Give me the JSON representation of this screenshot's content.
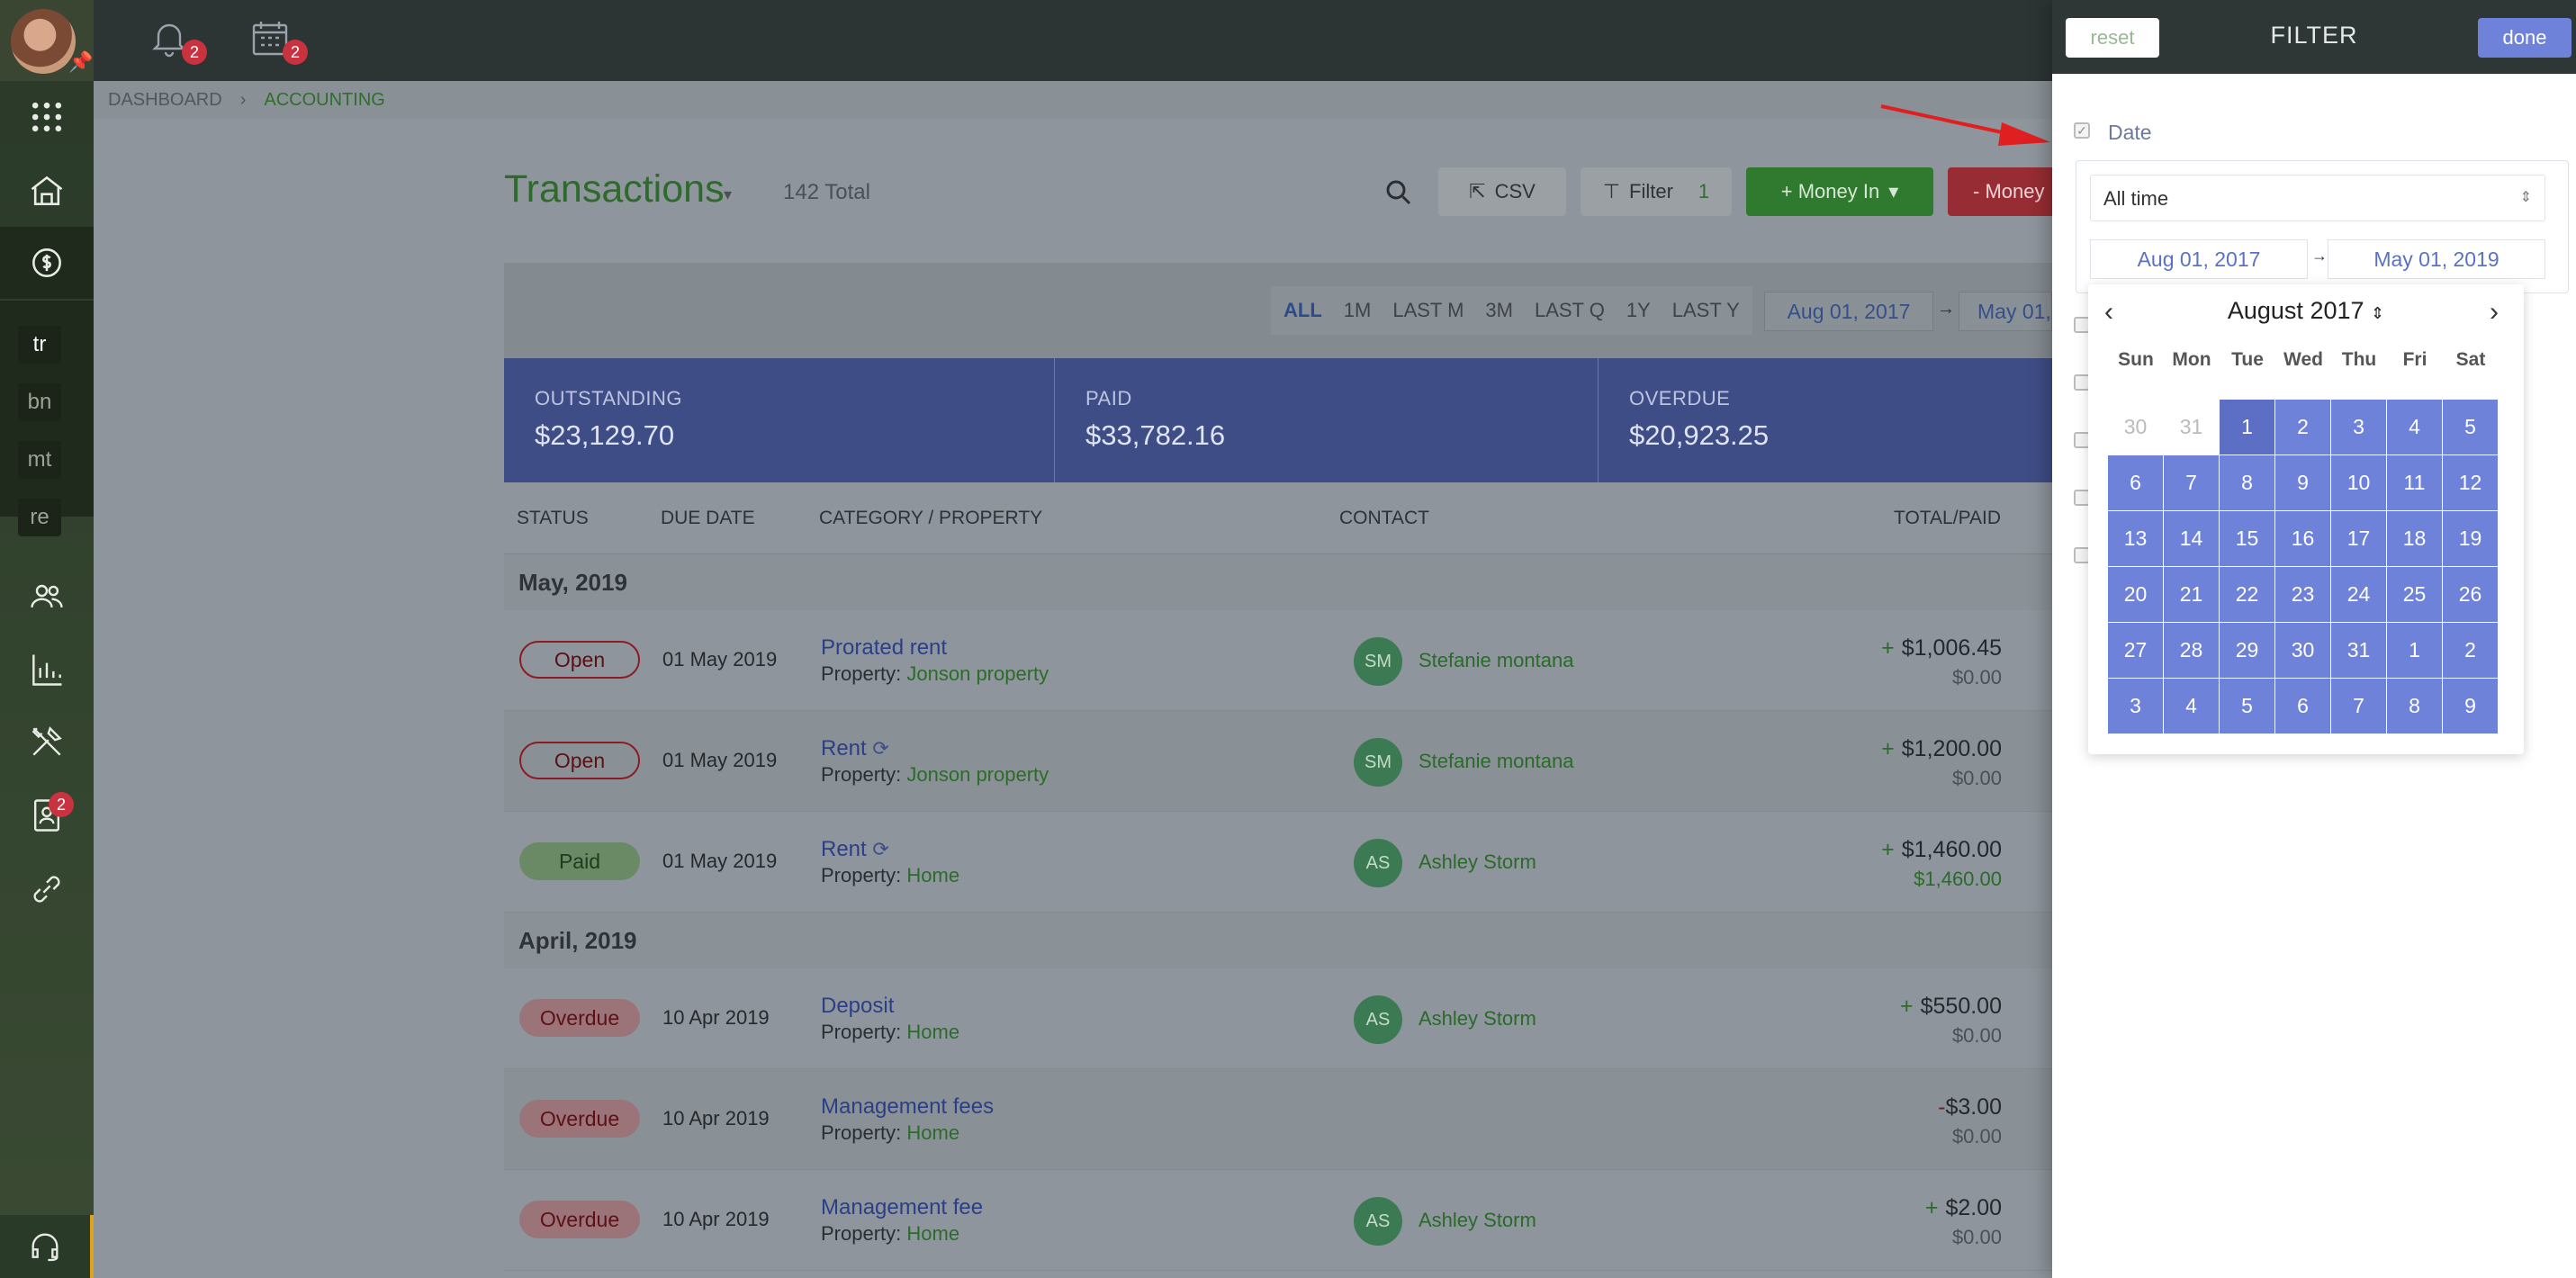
{
  "sidebar": {
    "nav_icons": [
      "apps-grid-icon",
      "home-icon",
      "accounting-icon"
    ],
    "tags": [
      "tr",
      "bn",
      "mt",
      "re"
    ],
    "lower_icons": [
      "people-icon",
      "reports-icon",
      "tools-icon",
      "contacts-icon",
      "link-icon"
    ],
    "contacts_badge": "2"
  },
  "topbar": {
    "notifications_badge": "2",
    "calendar_badge": "2"
  },
  "breadcrumb": {
    "root": "DASHBOARD",
    "current": "ACCOUNTING"
  },
  "header": {
    "title": "Transactions",
    "total": "142 Total",
    "csv_label": "CSV",
    "filter_label": "Filter",
    "filter_count": "1",
    "money_in_label": "+ Money In",
    "money_out_label": "- Money"
  },
  "periods": [
    "ALL",
    "1M",
    "LAST M",
    "3M",
    "LAST Q",
    "1Y",
    "LAST Y"
  ],
  "range": {
    "from": "Aug 01, 2017",
    "to": "May 01,"
  },
  "stats": [
    {
      "label": "OUTSTANDING",
      "value": "$23,129.70"
    },
    {
      "label": "PAID",
      "value": "$33,782.16"
    },
    {
      "label": "OVERDUE",
      "value": "$20,923.25"
    }
  ],
  "columns": [
    "STATUS",
    "DUE DATE",
    "CATEGORY / PROPERTY",
    "CONTACT",
    "TOTAL/PAID"
  ],
  "groups": [
    {
      "month": "May, 2019",
      "rows": [
        {
          "status": "Open",
          "due": "01 May 2019",
          "category": "Prorated rent",
          "property_label": "Property:",
          "property": "Jonson property",
          "initials": "SM",
          "contact": "Stefanie montana",
          "sign": "+",
          "total": "$1,006.45",
          "paid": "$0.00"
        },
        {
          "status": "Open",
          "due": "01 May 2019",
          "category": "Rent",
          "recurring": true,
          "property_label": "Property:",
          "property": "Jonson property",
          "initials": "SM",
          "contact": "Stefanie montana",
          "sign": "+",
          "total": "$1,200.00",
          "paid": "$0.00"
        },
        {
          "status": "Paid",
          "due": "01 May 2019",
          "category": "Rent",
          "recurring": true,
          "property_label": "Property:",
          "property": "Home",
          "initials": "AS",
          "contact": "Ashley Storm",
          "sign": "+",
          "total": "$1,460.00",
          "paid": "$1,460.00"
        }
      ]
    },
    {
      "month": "April, 2019",
      "rows": [
        {
          "status": "Overdue",
          "due": "10 Apr 2019",
          "category": "Deposit",
          "property_label": "Property:",
          "property": "Home",
          "initials": "AS",
          "contact": "Ashley Storm",
          "sign": "+",
          "total": "$550.00",
          "paid": "$0.00"
        },
        {
          "status": "Overdue",
          "due": "10 Apr 2019",
          "category": "Management fees",
          "property_label": "Property:",
          "property": "Home",
          "initials": "",
          "contact": "",
          "sign": "-",
          "total": "$3.00",
          "paid": "$0.00"
        },
        {
          "status": "Overdue",
          "due": "10 Apr 2019",
          "category": "Management fee",
          "property_label": "Property:",
          "property": "Home",
          "initials": "AS",
          "contact": "Ashley Storm",
          "sign": "+",
          "total": "$2.00",
          "paid": "$0.00"
        }
      ]
    }
  ],
  "filter": {
    "reset_label": "reset",
    "title": "FILTER",
    "done_label": "done",
    "date_label": "Date",
    "date_option": "All time",
    "from": "Aug 01, 2017",
    "to": "May 01, 2019"
  },
  "calendar": {
    "month": "August",
    "year": "2017",
    "weekdays": [
      "Sun",
      "Mon",
      "Tue",
      "Wed",
      "Thu",
      "Fri",
      "Sat"
    ],
    "days": [
      "30",
      "31",
      "1",
      "2",
      "3",
      "4",
      "5",
      "6",
      "7",
      "8",
      "9",
      "10",
      "11",
      "12",
      "13",
      "14",
      "15",
      "16",
      "17",
      "18",
      "19",
      "20",
      "21",
      "22",
      "23",
      "24",
      "25",
      "26",
      "27",
      "28",
      "29",
      "30",
      "31",
      "1",
      "2",
      "3",
      "4",
      "5",
      "6",
      "7",
      "8",
      "9"
    ],
    "muted_count": 2,
    "selected_index": 2
  },
  "colors": {
    "accent": "#6d82d8",
    "brand_green": "#2e6a2b",
    "danger": "#c8333f"
  }
}
